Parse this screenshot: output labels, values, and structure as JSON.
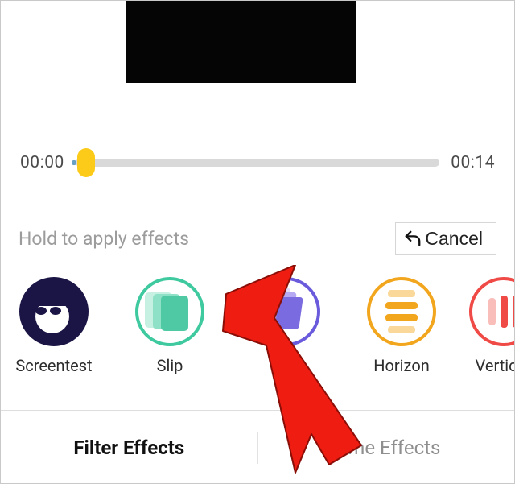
{
  "timeline": {
    "start": "00:00",
    "end": "00:14"
  },
  "hint": "Hold to apply effects",
  "cancel_label": "Cancel",
  "effects": [
    {
      "label": "Screentest"
    },
    {
      "label": "Slip"
    },
    {
      "label": ""
    },
    {
      "label": "Horizon"
    },
    {
      "label": "Vertica"
    }
  ],
  "tabs": {
    "filter": "Filter Effects",
    "time": "Time Effects"
  }
}
